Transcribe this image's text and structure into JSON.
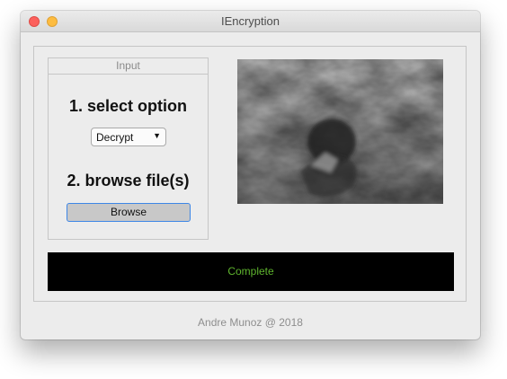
{
  "window": {
    "title": "IEncryption"
  },
  "input_panel": {
    "header": "Input",
    "step1_label": "1. select option",
    "option_selected": "Decrypt",
    "step2_label": "2. browse file(s)",
    "browse_label": "Browse"
  },
  "preview": {
    "icon": "image-preview"
  },
  "status": {
    "text": "Complete",
    "color": "#5fb52e"
  },
  "footer": {
    "credit": "Andre Munoz @ 2018"
  }
}
